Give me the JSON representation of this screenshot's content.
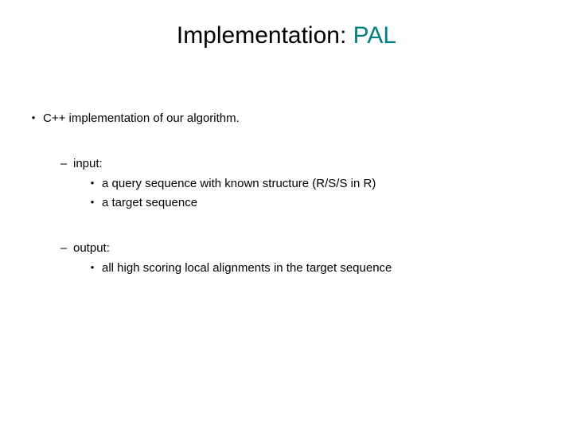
{
  "title": {
    "impl": "Implementation: ",
    "pal": "PAL"
  },
  "body": {
    "main": "C++ implementation of our algorithm.",
    "input": {
      "label": "input:",
      "items": [
        "a query sequence with known structure (R/S/S in R)",
        "a target sequence"
      ]
    },
    "output": {
      "label": "output:",
      "items": [
        "all high scoring local alignments in the target sequence"
      ]
    }
  },
  "bullets": {
    "dot": "•",
    "dash": "–"
  }
}
